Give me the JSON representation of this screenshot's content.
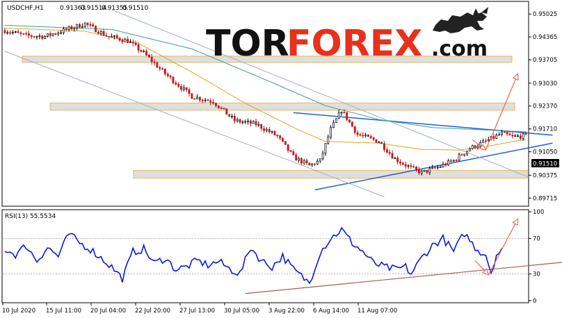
{
  "chart_data": [
    {
      "type": "candlestick",
      "title": "USDCHF,H1",
      "ohlc_header": [
        "0.91363",
        "0.91514",
        "0.91355",
        "0.91510"
      ],
      "current_price": "0.91510",
      "ylim": [
        0.895,
        0.9535
      ],
      "y_ticks": [
        "0.95025",
        "0.94365",
        "0.93705",
        "0.93030",
        "0.92370",
        "0.91710",
        "0.91050",
        "0.90375",
        "0.89715"
      ],
      "y_tick_values": [
        0.95025,
        0.94365,
        0.93705,
        0.9303,
        0.9237,
        0.9171,
        0.9105,
        0.90375,
        0.89715
      ],
      "x_labels": [
        "10 Jul 2020",
        "15 Jul 11:00",
        "20 Jul 04:00",
        "22 Jul 20:00",
        "27 Jul 13:00",
        "30 Jul 05:00",
        "3 Aug 22:00",
        "6 Aug 14:00",
        "11 Aug 07:00"
      ],
      "price_path_anchors": [
        [
          0,
          0.9455
        ],
        [
          8,
          0.944
        ],
        [
          15,
          0.9438
        ],
        [
          22,
          0.9455
        ],
        [
          30,
          0.9475
        ],
        [
          38,
          0.944
        ],
        [
          46,
          0.9425
        ],
        [
          52,
          0.939
        ],
        [
          60,
          0.933
        ],
        [
          70,
          0.9265
        ],
        [
          78,
          0.925
        ],
        [
          86,
          0.9195
        ],
        [
          94,
          0.9185
        ],
        [
          102,
          0.915
        ],
        [
          108,
          0.909
        ],
        [
          114,
          0.9065
        ],
        [
          118,
          0.908
        ],
        [
          122,
          0.917
        ],
        [
          126,
          0.9225
        ],
        [
          132,
          0.9155
        ],
        [
          140,
          0.9135
        ],
        [
          146,
          0.9085
        ],
        [
          152,
          0.9058
        ],
        [
          156,
          0.9045
        ],
        [
          162,
          0.906
        ],
        [
          168,
          0.908
        ],
        [
          174,
          0.9115
        ],
        [
          180,
          0.9135
        ],
        [
          186,
          0.9158
        ],
        [
          190,
          0.9148
        ],
        [
          194,
          0.9151
        ]
      ],
      "moving_averages": [
        {
          "color": "#e4a21a",
          "anchors": [
            [
              0,
              0.9462
            ],
            [
              30,
              0.9453
            ],
            [
              50,
              0.9418
            ],
            [
              70,
              0.9335
            ],
            [
              90,
              0.9245
            ],
            [
              110,
              0.9168
            ],
            [
              120,
              0.9135
            ],
            [
              140,
              0.913
            ],
            [
              156,
              0.9112
            ],
            [
              170,
              0.911
            ],
            [
              180,
              0.912
            ],
            [
              194,
              0.914
            ]
          ]
        },
        {
          "color": "#2f9e9a",
          "anchors": [
            [
              0,
              0.947
            ],
            [
              40,
              0.9458
            ],
            [
              70,
              0.9402
            ],
            [
              100,
              0.9305
            ],
            [
              120,
              0.9238
            ],
            [
              140,
              0.9198
            ],
            [
              160,
              0.9175
            ],
            [
              180,
              0.9168
            ],
            [
              194,
              0.9163
            ]
          ]
        }
      ],
      "zones": [
        {
          "low": 0.9363,
          "high": 0.9381
        },
        {
          "low": 0.9225,
          "high": 0.9246
        },
        {
          "low": 0.9029,
          "high": 0.9051
        }
      ],
      "trendlines": [
        {
          "color": "#1f5fd6",
          "from": [
            108,
            0.9218
          ],
          "to": [
            205,
            0.9153
          ]
        },
        {
          "color": "#1f5fd6",
          "from": [
            116,
            0.8995
          ],
          "to": [
            205,
            0.913
          ]
        },
        {
          "color": "#9fb0bf",
          "from": [
            40,
            0.9515
          ],
          "to": [
            196,
            0.9032
          ]
        },
        {
          "color": "#9fb0bf",
          "from": [
            0,
            0.9395
          ],
          "to": [
            142,
            0.8975
          ]
        }
      ],
      "forecast_arrows": [
        {
          "color": "#f0614c",
          "from": [
            175,
            0.914
          ],
          "to": [
            180,
            0.911
          ]
        },
        {
          "color": "#f0614c",
          "from": [
            180,
            0.911
          ],
          "to": [
            192,
            0.933
          ]
        }
      ]
    },
    {
      "type": "line",
      "title": "RSI(13) 55.5534",
      "ylim": [
        0,
        100
      ],
      "y_ticks": [
        "100",
        "70",
        "30",
        "0"
      ],
      "y_tick_values": [
        100,
        70,
        30,
        0
      ],
      "levels": [
        70,
        30
      ],
      "series": [
        {
          "color": "#0a18e8",
          "anchors": [
            [
              0,
              58
            ],
            [
              4,
              52
            ],
            [
              8,
              62
            ],
            [
              12,
              45
            ],
            [
              16,
              60
            ],
            [
              20,
              50
            ],
            [
              24,
              75
            ],
            [
              28,
              65
            ],
            [
              32,
              58
            ],
            [
              36,
              48
            ],
            [
              40,
              38
            ],
            [
              44,
              25
            ],
            [
              48,
              55
            ],
            [
              52,
              58
            ],
            [
              56,
              42
            ],
            [
              60,
              48
            ],
            [
              64,
              35
            ],
            [
              68,
              38
            ],
            [
              72,
              45
            ],
            [
              76,
              40
            ],
            [
              80,
              44
            ],
            [
              84,
              36
            ],
            [
              88,
              30
            ],
            [
              92,
              60
            ],
            [
              96,
              45
            ],
            [
              100,
              38
            ],
            [
              104,
              50
            ],
            [
              108,
              35
            ],
            [
              112,
              25
            ],
            [
              114,
              20
            ],
            [
              118,
              55
            ],
            [
              122,
              70
            ],
            [
              126,
              80
            ],
            [
              130,
              65
            ],
            [
              134,
              55
            ],
            [
              138,
              42
            ],
            [
              142,
              38
            ],
            [
              146,
              35
            ],
            [
              150,
              38
            ],
            [
              152,
              30
            ],
            [
              156,
              48
            ],
            [
              160,
              62
            ],
            [
              164,
              70
            ],
            [
              168,
              55
            ],
            [
              172,
              76
            ],
            [
              176,
              60
            ],
            [
              178,
              55
            ],
            [
              180,
              52
            ],
            [
              182,
              32
            ],
            [
              184,
              52
            ],
            [
              186,
              56
            ]
          ]
        }
      ],
      "trendline": {
        "color": "#a05a5a",
        "from": [
          90,
          8
        ],
        "to": [
          215,
          45
        ]
      },
      "forecast_arrows": [
        {
          "color": "#f0614c",
          "from": [
            176,
            45
          ],
          "to": [
            181,
            29
          ]
        },
        {
          "color": "#f0614c",
          "from": [
            181,
            29
          ],
          "to": [
            192,
            92
          ]
        }
      ]
    }
  ],
  "logo": {
    "part1": "TOR",
    "part2": "FOREX",
    "part3": ".com"
  },
  "colors": {
    "candle_up": "#000000",
    "candle_down": "#c4161c",
    "logo_dark": "#111111",
    "logo_red": "#e8301c",
    "zone_fill": "#d9d9d9",
    "zone_border": "#e6b85a",
    "price_label_bg": "#000000"
  }
}
